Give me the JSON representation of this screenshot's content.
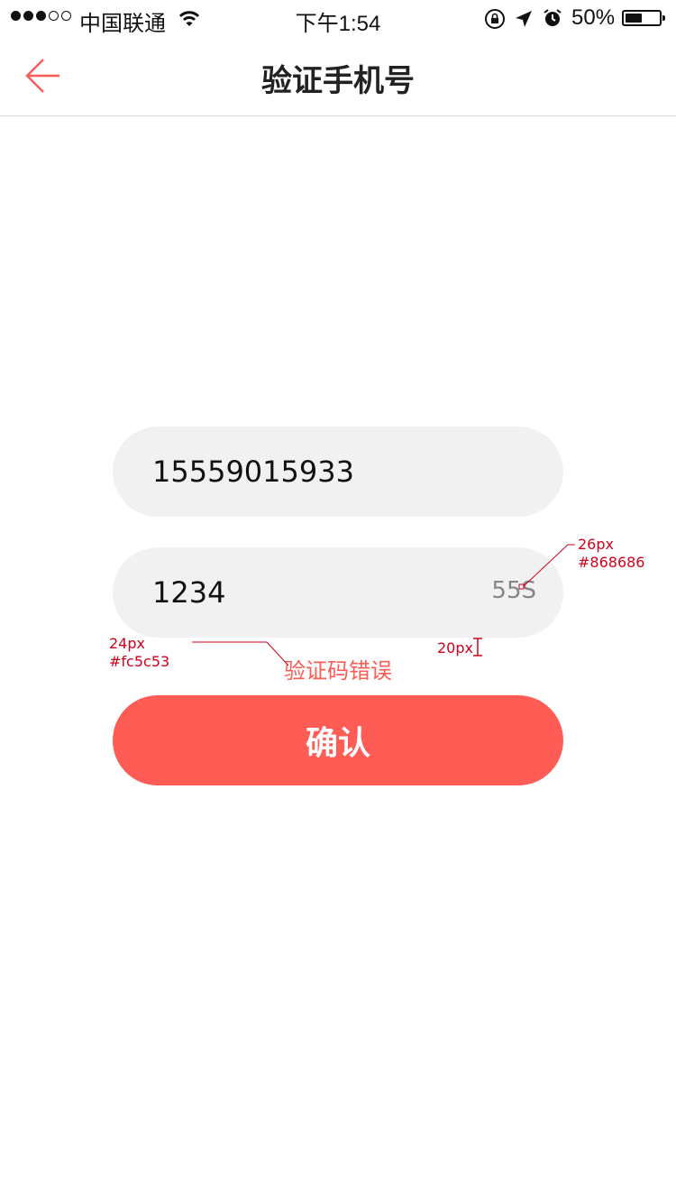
{
  "status_bar": {
    "carrier": "中国联通",
    "time": "下午1:54",
    "battery_percent": "50%",
    "battery_level": 0.5,
    "signal_filled": 3,
    "signal_total": 5
  },
  "nav": {
    "title": "验证手机号"
  },
  "form": {
    "phone_value": "15559015933",
    "code_value": "1234",
    "countdown": "55S",
    "error_message": "验证码错误",
    "confirm_label": "确认"
  },
  "annotations": {
    "countdown_size": "26px",
    "countdown_color": "#868686",
    "error_size": "24px",
    "error_color": "#fc5c53",
    "spacing": "20px"
  },
  "colors": {
    "accent": "#fe5c54",
    "error": "#fc5c53",
    "countdown": "#868686",
    "field_bg": "#f1f1f1"
  }
}
